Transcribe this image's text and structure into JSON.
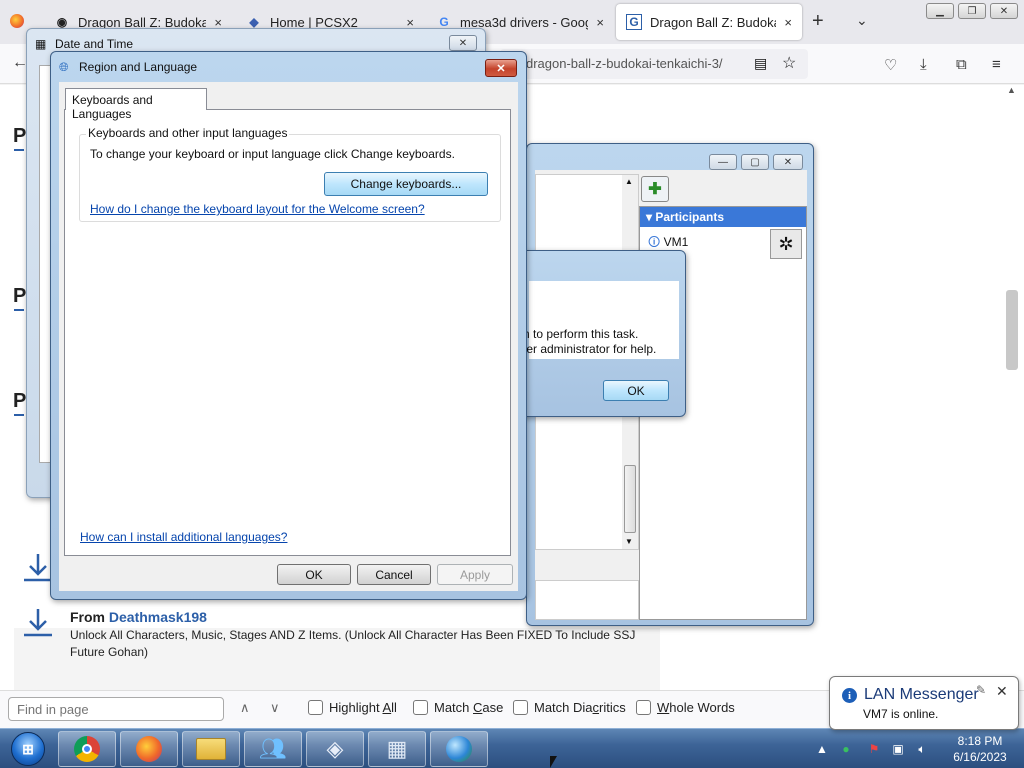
{
  "browser": {
    "tabs": [
      {
        "title": "Dragon Ball Z: Budokai Te",
        "close": "×"
      },
      {
        "title": "Home | PCSX2",
        "close": "×"
      },
      {
        "title": "mesa3d drivers - Google",
        "close": "×"
      },
      {
        "title": "Dragon Ball Z: Budokai Te",
        "close": "×"
      }
    ],
    "new_tab": "+",
    "tab_list": "⌄",
    "url": "dragon-ball-z-budokai-tenkaichi-3/",
    "window_controls": [
      "▁",
      "❐",
      "✕"
    ]
  },
  "webpage": {
    "letters": [
      "P",
      "P",
      "P"
    ],
    "entry_from_prefix": "From",
    "entry_author": "Deathmask198",
    "entry_description": "Unlock All Characters, Music, Stages AND Z Items. (Unlock All Character Has Been FIXED To Include SSJ Future Gohan)"
  },
  "findbar": {
    "placeholder": "Find in page",
    "up": "∧",
    "down": "∨",
    "options": [
      {
        "pre": "Highlight ",
        "key": "A",
        "post": "ll"
      },
      {
        "pre": "Match ",
        "key": "C",
        "post": "ase"
      },
      {
        "pre": "Match Dia",
        "key": "c",
        "post": "ritics"
      },
      {
        "pre": "",
        "key": "W",
        "post": "hole Words"
      }
    ]
  },
  "date_time_window": {
    "title": "Date and Time",
    "close": "✕"
  },
  "lan_window": {
    "participants_header": "Participants",
    "participant": "VM1",
    "controls": [
      "—",
      "▢",
      "✕"
    ]
  },
  "error_dialog": {
    "line1": "n to perform this task.",
    "line2": "ter administrator for help.",
    "ok": "OK"
  },
  "region_language": {
    "title": "Region and Language",
    "tab": "Keyboards and Languages",
    "group_label": "Keyboards and other input languages",
    "description": "To change your keyboard or input language click Change keyboards.",
    "change_keyboards": "Change keyboards...",
    "welcome_link": "How do I change the keyboard layout for the Welcome screen?",
    "install_link": "How can I install additional languages?",
    "ok": "OK",
    "cancel": "Cancel",
    "apply": "Apply",
    "close": "✕"
  },
  "taskbar": {
    "apps": [
      "chrome",
      "firefox",
      "explorer",
      "lan-messenger",
      "pcsx2",
      "date-time",
      "internet"
    ],
    "clock_time": "8:18 PM",
    "clock_date": "6/16/2023"
  },
  "balloon": {
    "title": "LAN Messenger",
    "message": "VM7 is online.",
    "close": "✕"
  },
  "colors": {
    "accent": "#2c5fa8",
    "participants_header": "#3a78d8",
    "link": "#0645ad",
    "taskbar": "#3d6497"
  }
}
